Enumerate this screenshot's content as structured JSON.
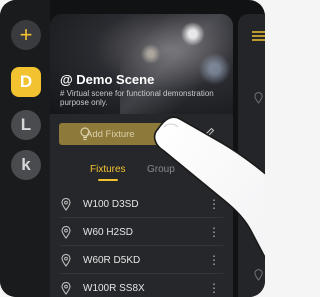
{
  "rail": {
    "add_label": "+",
    "items": [
      {
        "label": "D",
        "active": true
      },
      {
        "label": "L",
        "active": false
      },
      {
        "label": "k",
        "active": false
      }
    ]
  },
  "scene": {
    "title": "@ Demo Scene",
    "description": "# Virtual scene for functional demonstration purpose only.",
    "add_button_label": "Add Fixture",
    "icons": [
      "bulb-icon",
      "edit-icon"
    ]
  },
  "tabs": [
    {
      "label": "Fixtures",
      "active": true
    },
    {
      "label": "Group",
      "active": false
    }
  ],
  "fixtures": [
    {
      "name": "W100 D3SD"
    },
    {
      "name": "W60 H2SD"
    },
    {
      "name": "W60R D5KD"
    },
    {
      "name": "W100R SS8X"
    }
  ],
  "colors": {
    "accent": "#f2c230",
    "background": "#111214",
    "panel": "#26272a"
  }
}
